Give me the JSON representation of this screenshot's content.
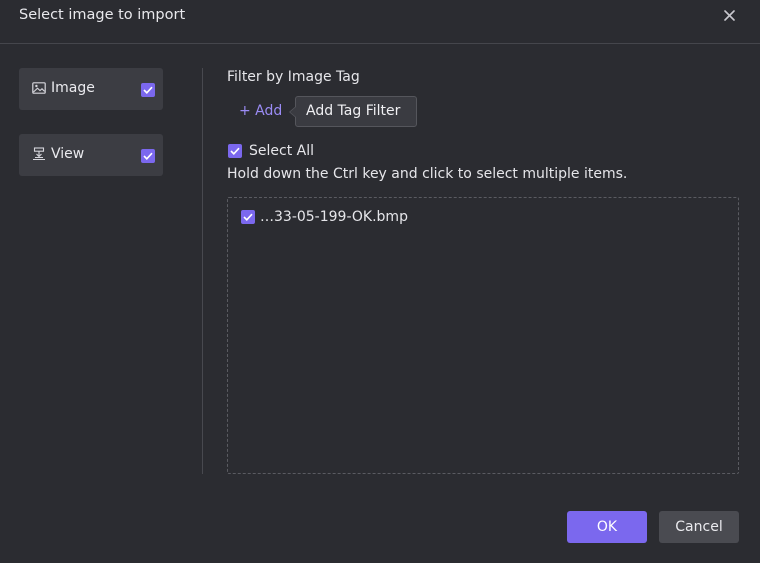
{
  "dialog": {
    "title": "Select image to import",
    "close_icon": "close-icon"
  },
  "sidebar": {
    "items": [
      {
        "label": "Image",
        "icon": "image-icon",
        "checked": true
      },
      {
        "label": "View",
        "icon": "view-icon",
        "checked": true
      }
    ]
  },
  "filter": {
    "label": "Filter by Image Tag",
    "add_label": "+ Add",
    "tooltip": "Add Tag Filter"
  },
  "selection": {
    "select_all_label": "Select All",
    "select_all_checked": true,
    "hint": "Hold down the Ctrl key and click to select multiple items."
  },
  "files": [
    {
      "name": "…33-05-199-OK.bmp",
      "checked": true
    }
  ],
  "footer": {
    "ok_label": "OK",
    "cancel_label": "Cancel"
  },
  "colors": {
    "background": "#2b2c31",
    "accent": "#7b68ee",
    "panel": "#3c3d43",
    "link": "#9b8cf5"
  }
}
